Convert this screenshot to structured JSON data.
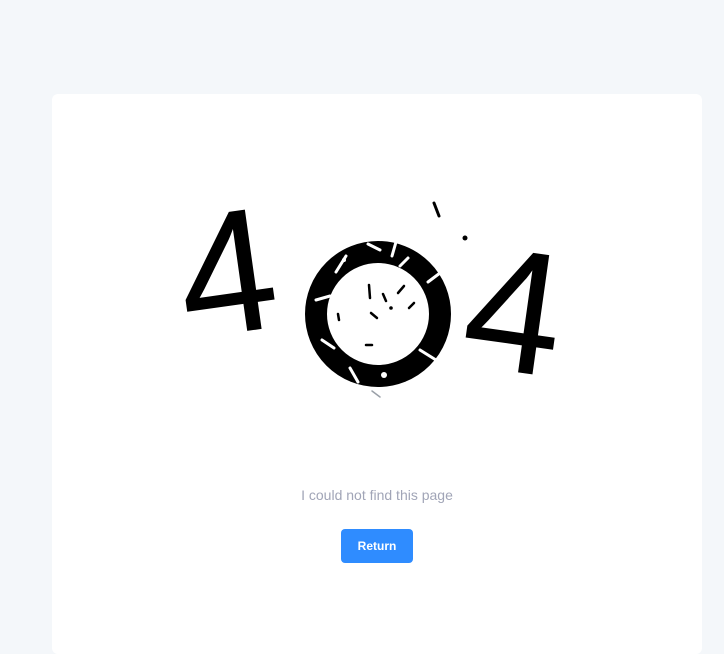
{
  "error": {
    "digit_left": "4",
    "digit_right": "4"
  },
  "message": "I could not find this page",
  "actions": {
    "return_label": "Return"
  },
  "colors": {
    "page_bg": "#f4f7fa",
    "card_bg": "#ffffff",
    "glyph": "#000000",
    "message_text": "#a1a5b7",
    "button_bg": "#2f8cff",
    "button_text": "#ffffff"
  }
}
